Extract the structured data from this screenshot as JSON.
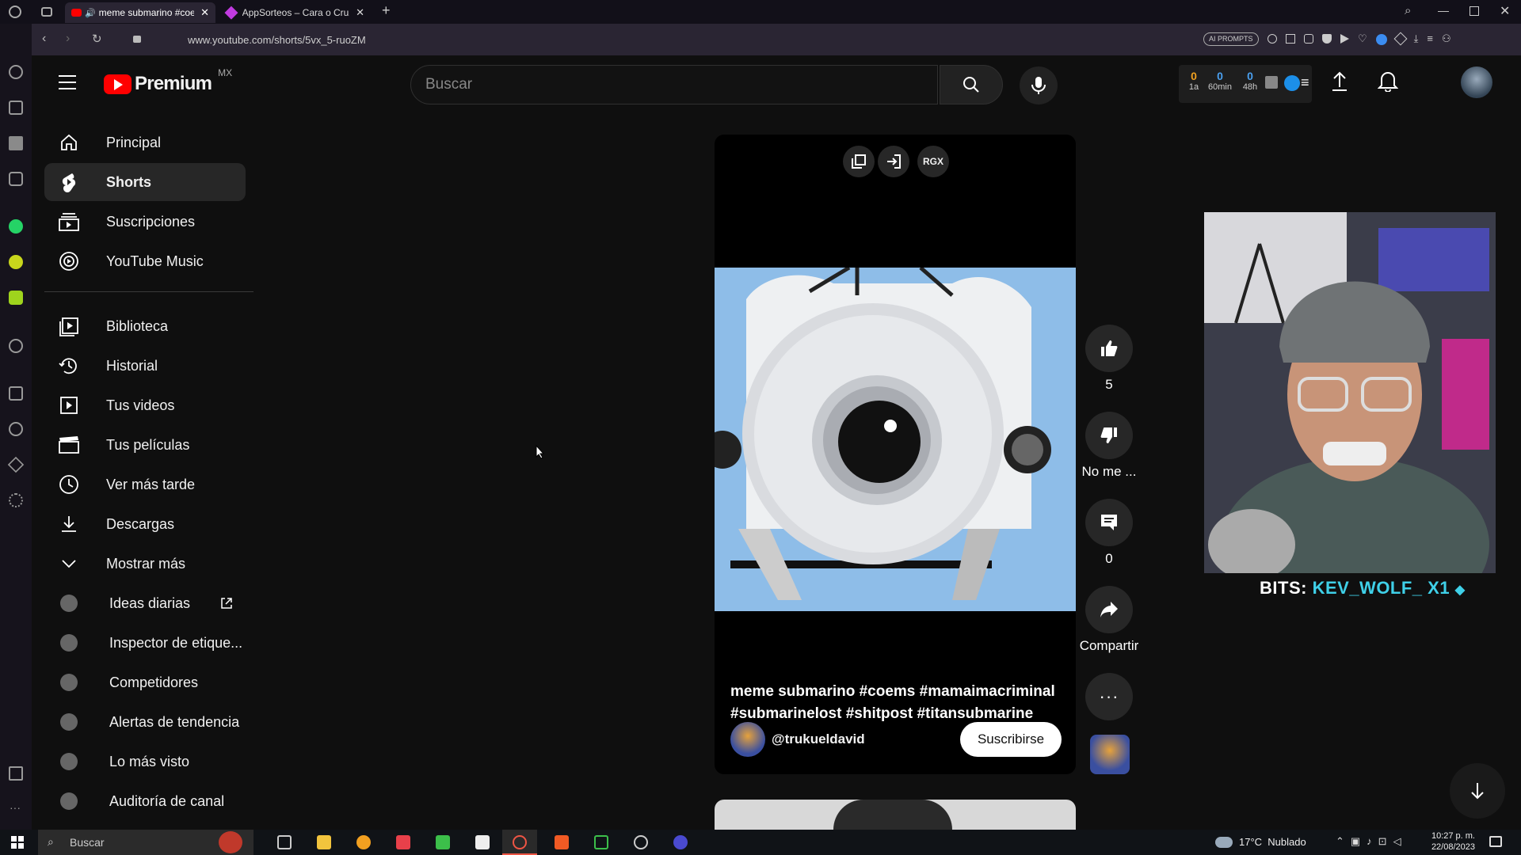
{
  "browser": {
    "tabs": [
      {
        "title": "meme submarino #coe",
        "active": true
      },
      {
        "title": "AppSorteos – Cara o Cruz",
        "active": false
      }
    ],
    "url": "www.youtube.com/shorts/5vx_5-ruoZM",
    "ai_prompts_label": "AI PROMPTS"
  },
  "youtube": {
    "logo_text": "Premium",
    "region": "MX",
    "search_placeholder": "Buscar",
    "sidebar": {
      "primary": [
        {
          "label": "Principal",
          "icon": "home-icon"
        },
        {
          "label": "Shorts",
          "icon": "shorts-icon",
          "selected": true
        },
        {
          "label": "Suscripciones",
          "icon": "subscriptions-icon"
        },
        {
          "label": "YouTube Music",
          "icon": "youtube-music-icon"
        }
      ],
      "library": [
        {
          "label": "Biblioteca",
          "icon": "library-icon"
        },
        {
          "label": "Historial",
          "icon": "history-icon"
        },
        {
          "label": "Tus videos",
          "icon": "your-videos-icon"
        },
        {
          "label": "Tus películas",
          "icon": "movies-icon"
        },
        {
          "label": "Ver más tarde",
          "icon": "watch-later-icon"
        },
        {
          "label": "Descargas",
          "icon": "download-icon"
        },
        {
          "label": "Mostrar más",
          "icon": "chevron-down-icon"
        }
      ],
      "extensions": [
        {
          "label": "Ideas diarias"
        },
        {
          "label": "Inspector de etique..."
        },
        {
          "label": "Competidores"
        },
        {
          "label": "Alertas de tendencia"
        },
        {
          "label": "Lo más visto"
        },
        {
          "label": "Auditoría de canal"
        }
      ]
    },
    "stats_widget": {
      "items": [
        {
          "value": "0",
          "label": "1a"
        },
        {
          "value": "0",
          "label": "60min"
        },
        {
          "value": "0",
          "label": "48h"
        }
      ]
    },
    "short": {
      "overlay_buttons": [
        "RGX"
      ],
      "caption": "meme submarino #coems #mamaimacriminal #submarinelost #shitpost #titansubmarine",
      "channel": "@trukueldavid",
      "subscribe_label": "Suscribirse",
      "likes": "5",
      "dislike_label": "No me ...",
      "comments": "0",
      "share_label": "Compartir"
    },
    "stream_overlay": {
      "bits_label": "BITS:",
      "bits_user": "KEV_WOLF_ X1"
    }
  },
  "taskbar": {
    "search_placeholder": "Buscar",
    "weather": "17°C  Nublado",
    "time": "10:27 p. m.",
    "date": "22/08/2023"
  },
  "colors": {
    "youtube_red": "#ff0000",
    "background": "#0f0f0f",
    "sidebar_selected": "#272727",
    "bits_user": "#3fd0e8"
  }
}
